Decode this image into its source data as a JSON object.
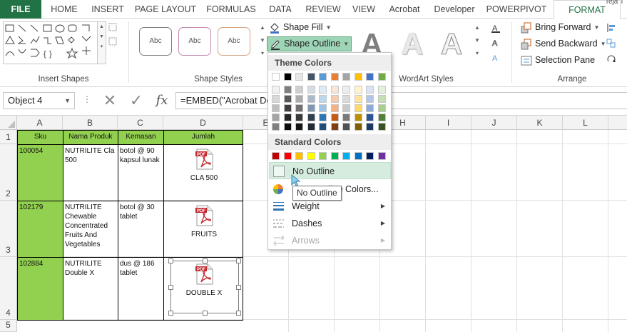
{
  "tabs": [
    {
      "label": "FILE"
    },
    {
      "label": "HOME"
    },
    {
      "label": "INSERT"
    },
    {
      "label": "PAGE LAYOUT"
    },
    {
      "label": "FORMULAS"
    },
    {
      "label": "DATA"
    },
    {
      "label": "REVIEW"
    },
    {
      "label": "VIEW"
    },
    {
      "label": "Acrobat"
    },
    {
      "label": "Developer"
    },
    {
      "label": "POWERPIVOT"
    },
    {
      "label": "FORMAT"
    }
  ],
  "user_name": "Teja T",
  "ribbon": {
    "groups": {
      "insert_shapes": "Insert Shapes",
      "shape_styles": "Shape Styles",
      "wordart_styles": "WordArt Styles",
      "arrange": "Arrange"
    },
    "style_sample_text": "Abc",
    "wordart_letter": "A",
    "shape_fill_label": "Shape Fill",
    "shape_outline_label": "Shape Outline",
    "bring_forward_label": "Bring Forward",
    "send_backward_label": "Send Backward",
    "selection_pane_label": "Selection Pane"
  },
  "formula_bar": {
    "name_box": "Object 4",
    "fx_label": "fx",
    "formula": "=EMBED(\"Acrobat Document\",\"\")"
  },
  "columns": [
    "A",
    "B",
    "C",
    "D",
    "E",
    "F",
    "G",
    "H",
    "I",
    "J",
    "K",
    "L"
  ],
  "rows": [
    "1",
    "2",
    "3",
    "4",
    "5"
  ],
  "table": {
    "headers": [
      "Sku",
      "Nama Produk",
      "Kemasan",
      "Jumlah"
    ],
    "rows": [
      {
        "sku": "100054",
        "name": "NUTRILITE Cla 500",
        "pack": "botol @ 90 kapsul lunak",
        "pdf_label": "CLA 500"
      },
      {
        "sku": "102179",
        "name": "NUTRILITE Chewable Concentrated Fruits And Vegetables",
        "pack": "botol @ 30 tablet",
        "pdf_label": "FRUITS"
      },
      {
        "sku": "102884",
        "name": "NUTRILITE Double X",
        "pack": "dus @ 186 tablet",
        "pdf_label": "DOUBLE X"
      }
    ],
    "pdf_badge": "PDF"
  },
  "dropdown": {
    "theme_colors_label": "Theme Colors",
    "standard_colors_label": "Standard Colors",
    "theme_top": [
      "#ffffff",
      "#000000",
      "#e7e6e6",
      "#44546a",
      "#5b9bd5",
      "#ed7d31",
      "#a5a5a5",
      "#ffc000",
      "#4472c4",
      "#70ad47"
    ],
    "theme_shades": [
      [
        "#f2f2f2",
        "#7f7f7f",
        "#d0cece",
        "#d6dce4",
        "#deebf6",
        "#fbe5d5",
        "#ededed",
        "#fff2cc",
        "#dae3f3",
        "#e2efd9"
      ],
      [
        "#d8d8d8",
        "#595959",
        "#aeabab",
        "#adb9ca",
        "#bdd7ee",
        "#f7cbac",
        "#dbdbdb",
        "#fee599",
        "#b4c6e7",
        "#c5e0b3"
      ],
      [
        "#bfbfbf",
        "#3f3f3f",
        "#757070",
        "#8496b0",
        "#9dc3e6",
        "#f4b183",
        "#c9c9c9",
        "#ffd965",
        "#8eaadb",
        "#a8d08d"
      ],
      [
        "#a5a5a5",
        "#262626",
        "#3a3838",
        "#323f4f",
        "#2e75b5",
        "#c55a11",
        "#7b7b7b",
        "#bf8f00",
        "#2f5496",
        "#538135"
      ],
      [
        "#7f7f7f",
        "#0c0c0c",
        "#171616",
        "#222a35",
        "#1e4e79",
        "#833c0b",
        "#525252",
        "#7f6000",
        "#1f3864",
        "#375623"
      ]
    ],
    "standard": [
      "#c00000",
      "#ff0000",
      "#ffc000",
      "#ffff00",
      "#92d050",
      "#00b050",
      "#00b0f0",
      "#0070c0",
      "#002060",
      "#7030a0"
    ],
    "items": {
      "no_outline": "No Outline",
      "more_colors": "More Outline Colors...",
      "weight": "Weight",
      "dashes": "Dashes",
      "arrows": "Arrows"
    },
    "tooltip": "No Outline"
  },
  "colors": {
    "accent": "#217346",
    "header_green": "#92d050",
    "pdf_red": "#c1272d"
  }
}
